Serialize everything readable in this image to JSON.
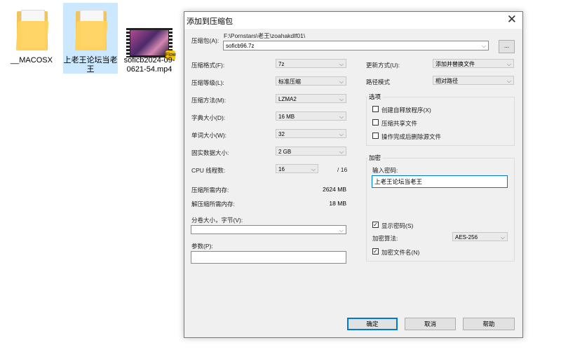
{
  "desktop": {
    "icons": [
      {
        "label": "__MACOSX"
      },
      {
        "label": "上老王论坛当老王"
      },
      {
        "label": "soficb2024-09-0621-54.mp4",
        "badge": "Flow"
      }
    ]
  },
  "dialog": {
    "title": "添加到压缩包",
    "close_symbol": "✕",
    "archive": {
      "label": "压缩包(A):",
      "path": "F:\\Pornstars\\老王\\zoahakdlf01\\",
      "name": "soficb96.7z",
      "browse_label": "..."
    },
    "left": {
      "format_label": "压缩格式(F):",
      "format_value": "7z",
      "level_label": "压缩等级(L):",
      "level_value": "标准压缩",
      "method_label": "压缩方法(M):",
      "method_value": "LZMA2",
      "dict_label": "字典大小(D):",
      "dict_value": "16 MB",
      "word_label": "单词大小(W):",
      "word_value": "32",
      "solid_label": "固实数据大小:",
      "solid_value": "2 GB",
      "cpu_label": "CPU 线程数:",
      "cpu_value": "16",
      "cpu_total": "/ 16",
      "mem_comp_label": "压缩所需内存:",
      "mem_comp_value": "2624 MB",
      "mem_decomp_label": "解压缩所需内存:",
      "mem_decomp_value": "18 MB",
      "split_label": "分卷大小，字节(V):",
      "split_value": "",
      "params_label": "参数(P):",
      "params_value": ""
    },
    "right": {
      "update_label": "更新方式(U):",
      "update_value": "添加并替换文件",
      "pathmode_label": "路径模式",
      "pathmode_value": "相对路径",
      "options_title": "选项",
      "opt_sfx": "创建自释放程序(X)",
      "opt_shared": "压缩共享文件",
      "opt_delete": "操作完成后删除源文件",
      "encrypt_title": "加密",
      "password_label": "输入密码:",
      "password_value": "上老王论坛当老王",
      "show_password": "显示密码(S)",
      "enc_method_label": "加密算法:",
      "enc_method_value": "AES-256",
      "enc_names": "加密文件名(N)"
    },
    "buttons": {
      "ok": "确定",
      "cancel": "取消",
      "help": "帮助"
    }
  }
}
